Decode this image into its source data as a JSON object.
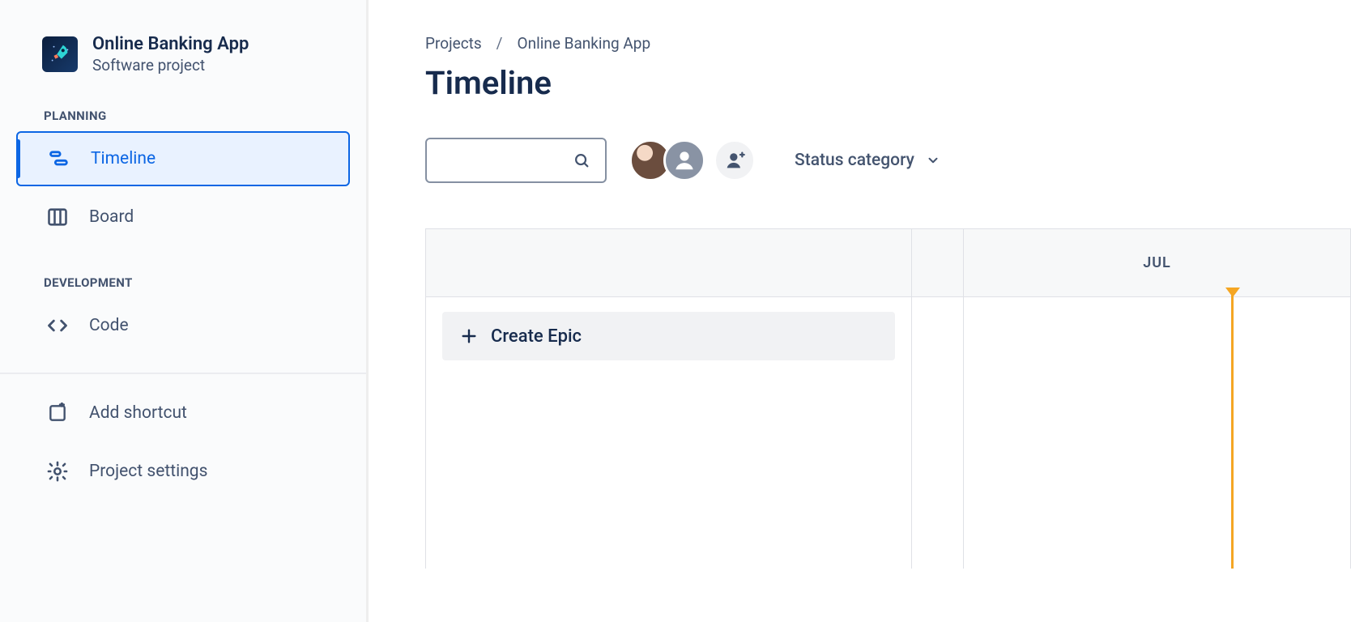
{
  "sidebar": {
    "project_name": "Online Banking App",
    "project_subtitle": "Software project",
    "sections": {
      "planning_label": "PLANNING",
      "development_label": "DEVELOPMENT"
    },
    "items": {
      "timeline": "Timeline",
      "board": "Board",
      "code": "Code",
      "add_shortcut": "Add shortcut",
      "project_settings": "Project settings"
    }
  },
  "breadcrumbs": {
    "root": "Projects",
    "project": "Online Banking App"
  },
  "page": {
    "title": "Timeline"
  },
  "toolbar": {
    "search_placeholder": "",
    "status_filter_label": "Status category"
  },
  "timeline": {
    "create_epic_label": "Create Epic",
    "month_label": "JUL"
  }
}
